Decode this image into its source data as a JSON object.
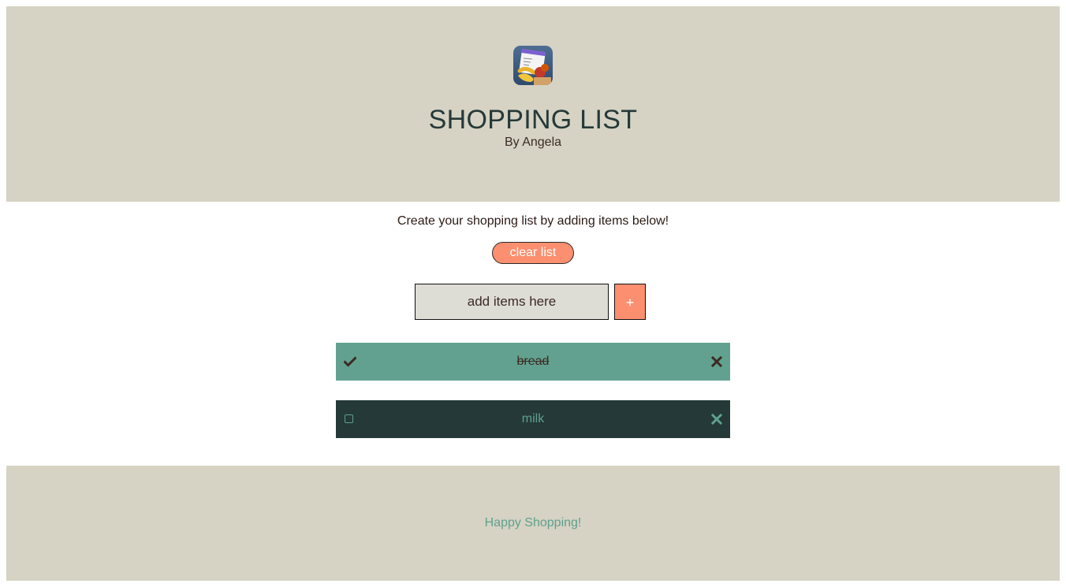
{
  "header": {
    "title": "SHOPPING LIST",
    "subtitle": "By Angela"
  },
  "intro_text": "Create your shopping list by adding items below!",
  "clear_button_label": "clear list",
  "add_form": {
    "placeholder": "add items here",
    "value": "",
    "add_button_label": "+"
  },
  "items": [
    {
      "label": "bread",
      "checked": true,
      "check_icon": "checkmark-icon",
      "remove_icon": "close-icon"
    },
    {
      "label": "milk",
      "checked": false,
      "check_icon": "checkbox-empty-icon",
      "remove_icon": "close-icon"
    }
  ],
  "footer_text": "Happy Shopping!",
  "colors": {
    "banner": "#d6d3c4",
    "accent": "#fc8f6f",
    "teal": "#62a18f",
    "dark": "#243938",
    "text": "#3b2a24"
  }
}
